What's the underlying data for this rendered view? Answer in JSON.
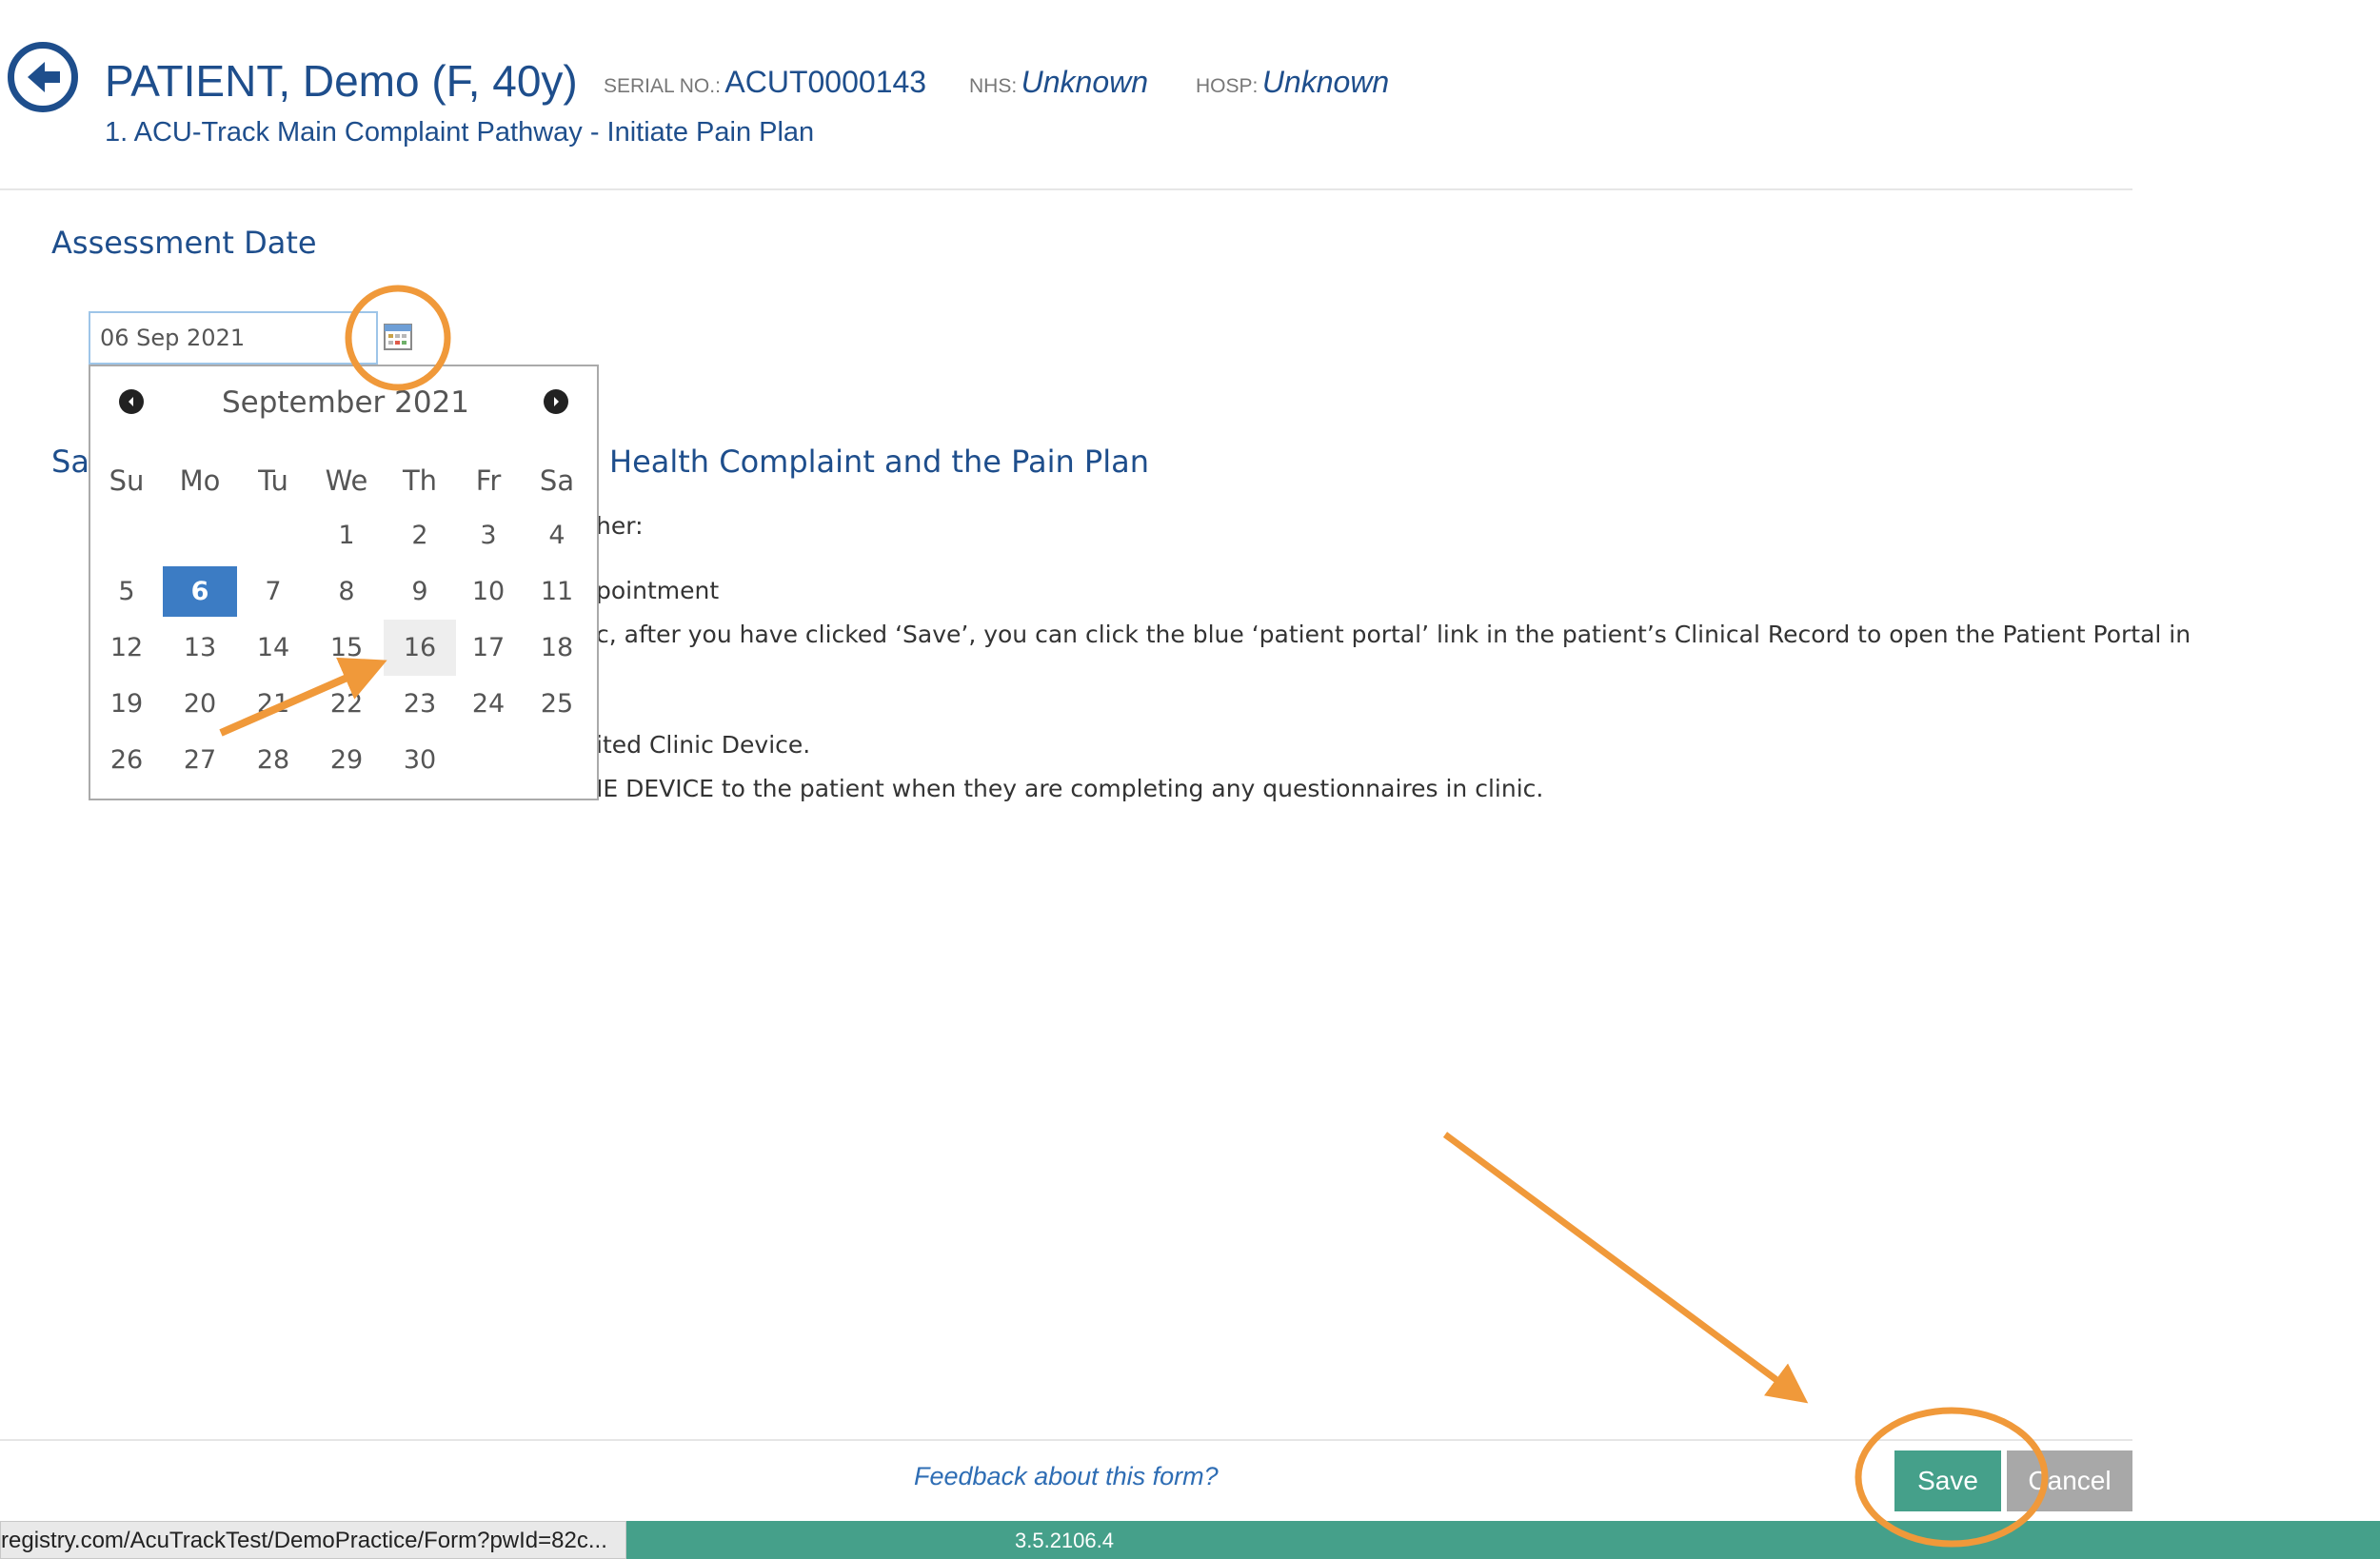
{
  "header": {
    "patient_name": "PATIENT, Demo (F, 40y)",
    "serial_label": "SERIAL NO.:",
    "serial_value": "ACUT0000143",
    "nhs_label": "NHS:",
    "nhs_value": "Unknown",
    "hosp_label": "HOSP:",
    "hosp_value": "Unknown",
    "pathway": "1. ACU-Track Main Complaint Pathway - Initiate Pain Plan"
  },
  "assessment": {
    "title": "Assessment Date",
    "date_value": "06 Sep 2021"
  },
  "content": {
    "section_title_left": "Sa",
    "section_title_right": "Health Complaint and the Pain Plan",
    "lines": [
      "her:",
      "pointment",
      "c, after you have clicked ‘Save’, you can click the blue ‘patient portal’ link in the patient’s Clinical Record to open the Patient Portal in",
      "ited Clinic Device.",
      "IE DEVICE to the patient when they are completing any questionnaires in clinic."
    ]
  },
  "calendar": {
    "month_label": "September 2021",
    "weekdays": [
      "Su",
      "Mo",
      "Tu",
      "We",
      "Th",
      "Fr",
      "Sa"
    ],
    "leading_blanks": 3,
    "days": [
      "1",
      "2",
      "3",
      "4",
      "5",
      "6",
      "7",
      "8",
      "9",
      "10",
      "11",
      "12",
      "13",
      "14",
      "15",
      "16",
      "17",
      "18",
      "19",
      "20",
      "21",
      "22",
      "23",
      "24",
      "25",
      "26",
      "27",
      "28",
      "29",
      "30"
    ],
    "selected_day": "6",
    "hover_day": "16"
  },
  "footer": {
    "feedback_link": "Feedback about this form?",
    "save_label": "Save",
    "cancel_label": "Cancel",
    "status_url": "registry.com/AcuTrackTest/DemoPractice/Form?pwId=82c...",
    "version": "3.5.2106.4"
  },
  "colors": {
    "brand_blue": "#1e4e8c",
    "selected_day": "#3c7cc4",
    "save_green": "#45a08a",
    "cancel_grey": "#a8a8a8",
    "annotation_orange": "#f0993a"
  }
}
